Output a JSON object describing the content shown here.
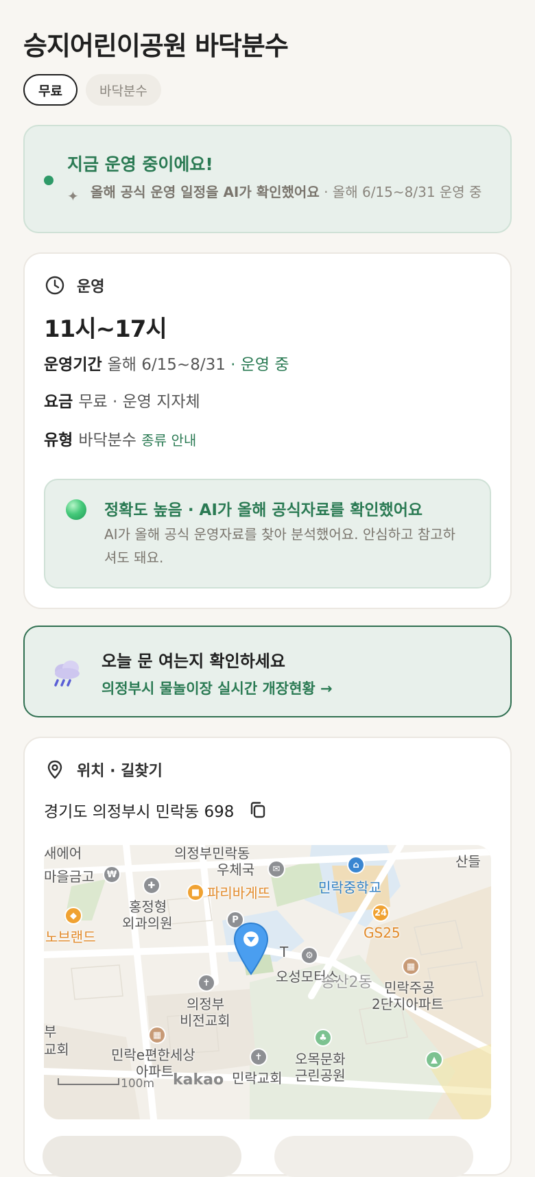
{
  "header": {
    "title": "승지어린이공원 바닥분수",
    "chips": [
      "무료",
      "바닥분수"
    ]
  },
  "status": {
    "title": "지금 운영 중이에요!",
    "desc_bold": "올해 공식 운영 일정을 AI가 확인했어요",
    "desc_rest": " · 올해 6/15~8/31 운영 중"
  },
  "hours": {
    "section_label": "운영",
    "time": "11시~17시",
    "period_label": "운영기간",
    "period_value": "올해 6/15~8/31",
    "period_status": " · 운영 중",
    "fee_label": "요금",
    "fee_value": "무료 · 운영 지자체",
    "type_label": "유형",
    "type_value": "바닥분수",
    "type_link": "종류 안내",
    "accuracy_title": "정확도 높음 · AI가 올해 공식자료를 확인했어요",
    "accuracy_desc": "AI가 올해 공식 운영자료를 찾아 분석했어요. 안심하고 참고하셔도 돼요."
  },
  "cta": {
    "title": "오늘 문 여는지 확인하세요",
    "link": "의정부시 물놀이장 실시간 개장현황 →"
  },
  "location": {
    "section_label": "위치 · 길찾기",
    "address": "경기도 의정부시 민락동 698",
    "map_labels": {
      "l1": "새에어",
      "l2": "의정부민락동",
      "l3": "우체국",
      "l4": "마을금고",
      "l5": "민락중학교",
      "l6": "산들",
      "l7": "홍정형",
      "l8": "외과의원",
      "l9": "파리바게뜨",
      "l10": "노브랜드",
      "l11": "GS25",
      "l12": "오성모터스",
      "l13": "송산2동",
      "l14": "민락주공",
      "l15": "2단지아파트",
      "l16": "의정부",
      "l17": "비전교회",
      "l18": "부",
      "l19": "교회",
      "l20": "민락e편한세상",
      "l21": "아파트",
      "l22": "오목문화",
      "l23": "근린공원",
      "l24": "민락교회",
      "l25": "T"
    },
    "scale": "100m",
    "kakao": "kakao"
  },
  "colors": {
    "accent_green": "#2a7a53",
    "status_bg": "#e8f0eb",
    "page_bg": "#f8f6f2"
  }
}
